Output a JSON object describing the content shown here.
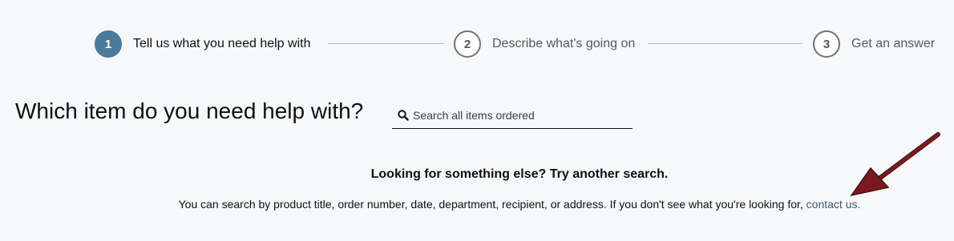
{
  "stepper": {
    "steps": [
      {
        "number": "1",
        "label": "Tell us what you need help with",
        "state": "active"
      },
      {
        "number": "2",
        "label": "Describe what's going on",
        "state": "inactive"
      },
      {
        "number": "3",
        "label": "Get an answer",
        "state": "inactive"
      }
    ]
  },
  "main": {
    "heading": "Which item do you need help with?",
    "search": {
      "placeholder": "Search all items ordered",
      "value": "",
      "icon": "search-icon"
    }
  },
  "message": {
    "title": "Looking for something else? Try another search.",
    "body_text": "You can search by product title, order number, date, department, recipient, or address. If you don't see what you're looking for, ",
    "link_text": "contact us."
  },
  "colors": {
    "active_step": "#4a7a9c",
    "link": "#3d5b6e",
    "annotation_arrow": "#7a1a1f",
    "background": "#f7f8fa"
  }
}
